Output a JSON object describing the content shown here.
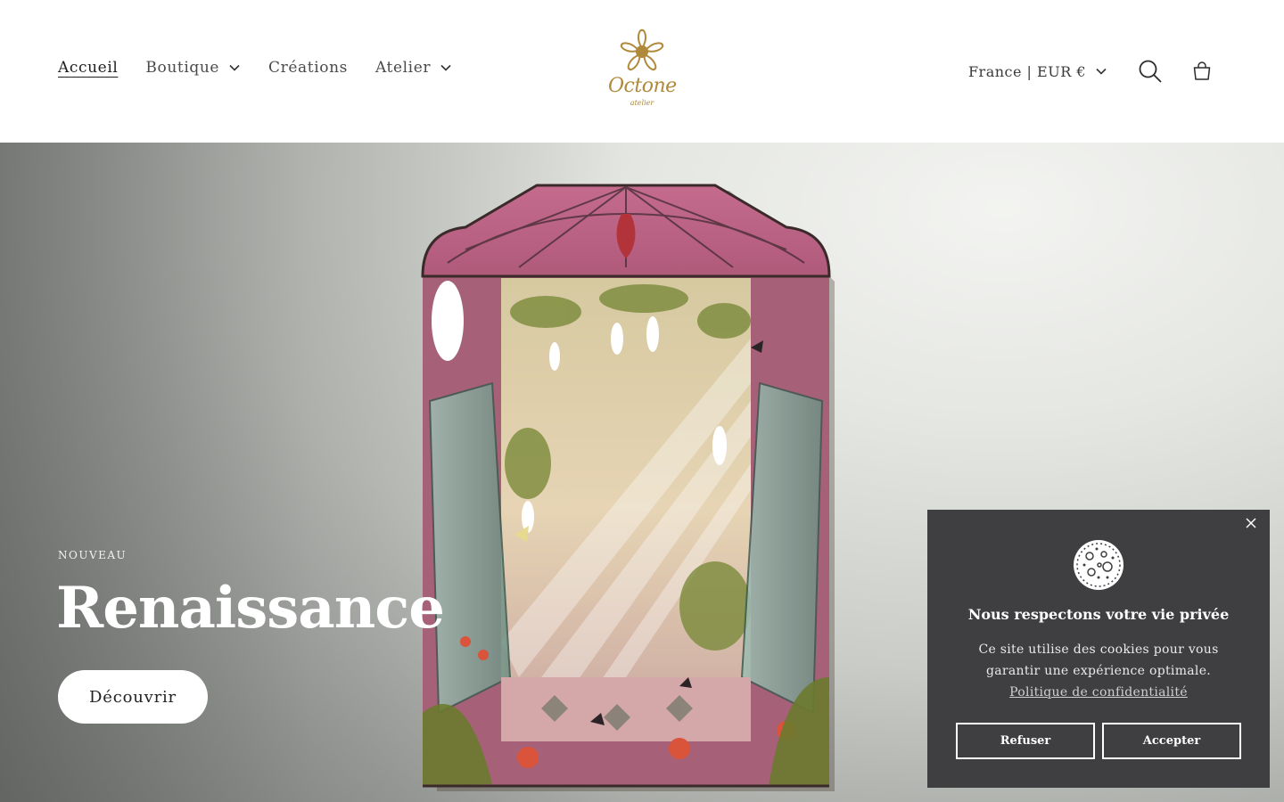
{
  "header": {
    "nav": [
      {
        "label": "Accueil",
        "active": true,
        "has_dropdown": false
      },
      {
        "label": "Boutique",
        "active": false,
        "has_dropdown": true
      },
      {
        "label": "Créations",
        "active": false,
        "has_dropdown": false
      },
      {
        "label": "Atelier",
        "active": false,
        "has_dropdown": true
      }
    ],
    "logo": {
      "name": "Octone",
      "sub": "atelier",
      "color": "#b0893a"
    },
    "country_selector": "France | EUR €",
    "icons": [
      "search-icon",
      "cart-icon",
      "chevron-down-icon"
    ]
  },
  "hero": {
    "kicker": "NOUVEAU",
    "title": "Renaissance",
    "button": "Découvrir"
  },
  "cookie_banner": {
    "title": "Nous respectons votre vie privée",
    "text": "Ce site utilise des cookies pour vous garantir une expérience optimale.",
    "policy_link": "Politique de confidentialité",
    "refuse": "Refuser",
    "accept": "Accepter",
    "icons": [
      "close-icon",
      "cookie-icon"
    ]
  },
  "colors": {
    "accent": "#b0893a",
    "banner_bg": "#3f3f42"
  }
}
